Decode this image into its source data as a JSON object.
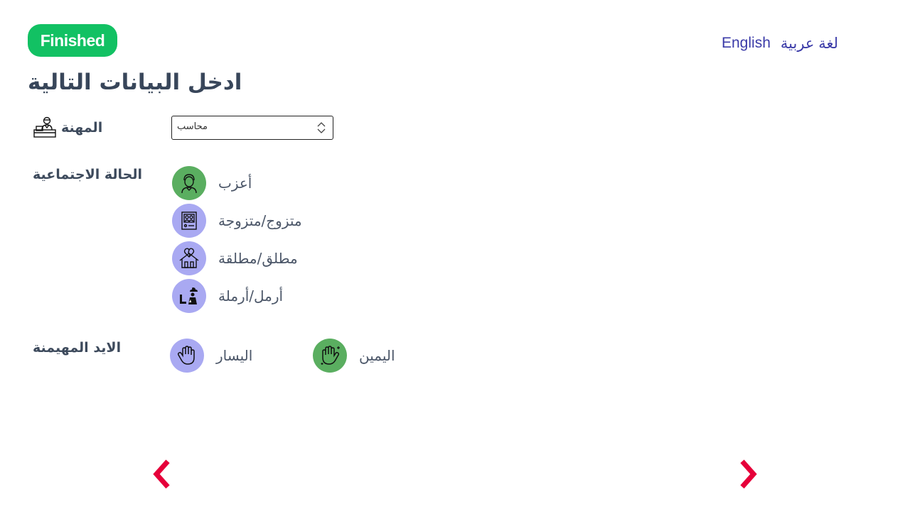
{
  "header": {
    "status_badge": "Finished",
    "lang_english": "English",
    "lang_arabic": "لغة عربية"
  },
  "title": "ادخل البيانات التالية",
  "profession": {
    "label": "المهنة",
    "icon": "accountant-icon",
    "selected": "محاسب"
  },
  "marital_status": {
    "label": "الحالة الاجتماعية",
    "options": [
      {
        "label": "أعزب",
        "icon": "single-person-icon",
        "selected": true
      },
      {
        "label": "متزوج/متزوجة",
        "icon": "wedding-photo-icon",
        "selected": false
      },
      {
        "label": "مطلق/مطلقة",
        "icon": "broken-home-icon",
        "selected": false
      },
      {
        "label": "أرمل/أرملة",
        "icon": "widow-grave-icon",
        "selected": false
      }
    ]
  },
  "dominant_hand": {
    "label": "الايد المهيمنة",
    "options": [
      {
        "label": "اليسار",
        "icon": "left-hand-icon",
        "selected": false
      },
      {
        "label": "اليمين",
        "icon": "right-hand-icon",
        "selected": true
      }
    ]
  },
  "colors": {
    "badge": "#12c163",
    "selected_option": "#5aae60",
    "unselected_option": "#a9a9f2",
    "nav_arrow": "#e6003a",
    "link": "#3b3ba8"
  },
  "navigation": {
    "prev_icon": "chevron-left-icon",
    "next_icon": "chevron-right-icon"
  }
}
